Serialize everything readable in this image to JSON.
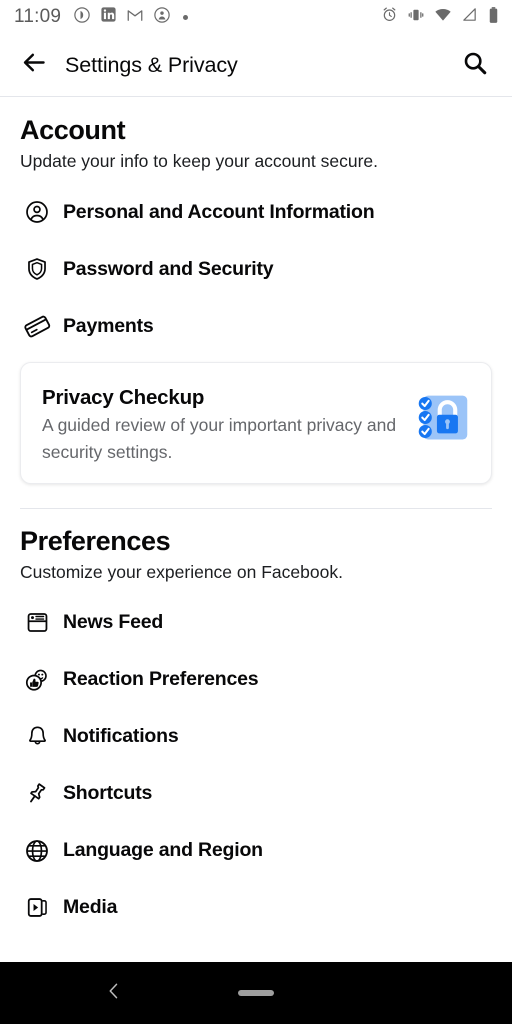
{
  "status_bar": {
    "time": "11:09",
    "left_icons": [
      "play-circle-icon",
      "linkedin-icon",
      "gmail-icon",
      "app-circle-icon",
      "more-dot-icon"
    ],
    "right_icons": [
      "alarm-icon",
      "vibrate-icon",
      "wifi-icon",
      "signal-icon",
      "battery-icon"
    ]
  },
  "header": {
    "back_icon": "back-arrow-icon",
    "title": "Settings & Privacy",
    "search_icon": "search-icon"
  },
  "sections": [
    {
      "title": "Account",
      "subtitle": "Update your info to keep your account secure.",
      "items": [
        {
          "label": "Personal and Account Information",
          "icon": "person-circle-icon"
        },
        {
          "label": "Password and Security",
          "icon": "shield-icon"
        },
        {
          "label": "Payments",
          "icon": "credit-card-icon"
        }
      ]
    },
    {
      "title": "Preferences",
      "subtitle": "Customize your experience on Facebook.",
      "items": [
        {
          "label": "News Feed",
          "icon": "news-feed-icon"
        },
        {
          "label": "Reaction Preferences",
          "icon": "reaction-icon"
        },
        {
          "label": "Notifications",
          "icon": "bell-icon"
        },
        {
          "label": "Shortcuts",
          "icon": "pin-icon"
        },
        {
          "label": "Language and Region",
          "icon": "globe-icon"
        },
        {
          "label": "Media",
          "icon": "media-icon"
        }
      ]
    }
  ],
  "privacy_card": {
    "title": "Privacy Checkup",
    "description": "A guided review of your important privacy and security settings.",
    "art_icon": "checklist-lock-icon"
  },
  "nav_bar": {
    "back_icon": "nav-back-chevron-icon",
    "home_indicator": "home-pill-indicator"
  },
  "colors": {
    "accent_blue": "#1877F2",
    "art_background": "#9BC4F8",
    "text_primary": "#080809",
    "text_secondary": "#65676B",
    "divider": "#E4E6EB",
    "nav_background": "#000000"
  }
}
